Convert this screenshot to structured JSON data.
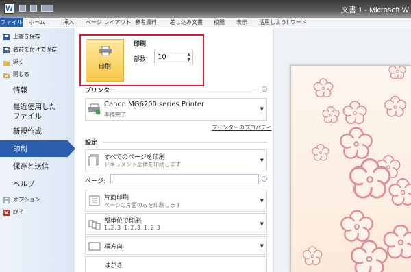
{
  "titlebar": {
    "logo": "W",
    "document_title": "文書 1 - Microsoft W"
  },
  "ribbon": {
    "tabs": [
      "ファイル",
      "ホーム",
      "挿入",
      "ページ レイアウト",
      "参考資料",
      "差し込み文書",
      "校閲",
      "表示",
      "活用しよう! ワード"
    ]
  },
  "backstage_nav": {
    "commands": [
      {
        "label": "上書き保存",
        "icon": "save-icon"
      },
      {
        "label": "名前を付けて保存",
        "icon": "save-as-icon"
      },
      {
        "label": "開く",
        "icon": "open-folder-icon"
      },
      {
        "label": "閉じる",
        "icon": "close-document-icon"
      }
    ],
    "info": "情報",
    "recent_line1": "最近使用した",
    "recent_line2": "ファイル",
    "new": "新規作成",
    "print": "印刷",
    "save_send": "保存と送信",
    "help": "ヘルプ",
    "options": {
      "label": "オプション",
      "icon": "options-icon"
    },
    "exit": {
      "label": "終了",
      "icon": "exit-icon"
    }
  },
  "print_panel": {
    "print_button_label": "印刷",
    "copies_title": "印刷",
    "copies_label": "部数:",
    "copies_value": "10",
    "printer_section": "プリンター",
    "printer_name": "Canon MG6200 series Printer",
    "printer_status": "準備完了",
    "printer_properties_link": "プリンターのプロパティ",
    "settings_section": "設定",
    "range_title": "すべてのページを印刷",
    "range_desc": "ドキュメント全体を印刷します",
    "pages_label": "ページ:",
    "sides_title": "片面印刷",
    "sides_desc": "ページの片面のみを印刷します",
    "collate_title": "部単位で印刷",
    "collate_desc": "1,2,3   1,2,3   1,2,3",
    "orientation_title": "横方向",
    "paper_title": "はがき"
  },
  "colors": {
    "accent": "#2a5fad",
    "highlight_box": "#e3132b",
    "print_button": "#f7c84a",
    "flower": "#e08e95"
  }
}
